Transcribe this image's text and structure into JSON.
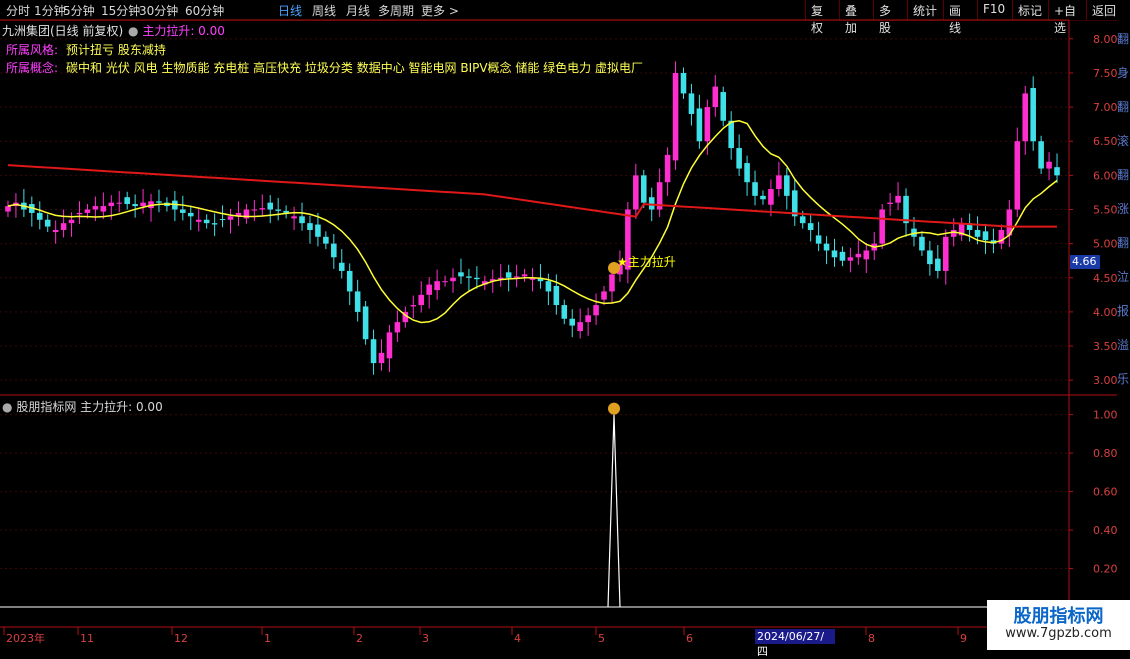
{
  "toolbar": {
    "left_items": [
      {
        "label": "分时",
        "active": false
      },
      {
        "label": "1分钟",
        "active": false
      },
      {
        "label": "5分钟",
        "active": false
      },
      {
        "label": "15分钟",
        "active": false
      },
      {
        "label": "30分钟",
        "active": false
      },
      {
        "label": "60分钟",
        "active": false
      },
      {
        "label": "日线",
        "active": true
      },
      {
        "label": "周线",
        "active": false
      },
      {
        "label": "月线",
        "active": false
      },
      {
        "label": "多周期",
        "active": false
      },
      {
        "label": "更多 >",
        "active": false
      }
    ],
    "right_items": [
      "复权",
      "叠加",
      "多股",
      "统计",
      "画线",
      "F10",
      "标记",
      "+自选",
      "返回"
    ]
  },
  "main_panel": {
    "stock_title": "九洲集团(日线 前复权)",
    "indicator_label": "主力拉升: 0.00",
    "style_label": "所属风格:",
    "style_value": "预计扭亏 股东减持",
    "concept_label": "所属概念:",
    "concept_value": "碳中和 光伏 风电 生物质能 充电桩 高压快充 垃圾分类 数据中心 智能电网 BIPV概念 储能 绿色电力 虚拟电厂",
    "signal_text": "★主力拉升",
    "current_price_tag": "4.66",
    "y_ticks": [
      "8.00",
      "7.50",
      "7.00",
      "6.50",
      "6.00",
      "5.50",
      "5.00",
      "4.50",
      "4.00",
      "3.50",
      "3.00"
    ]
  },
  "sub_panel": {
    "title": "股朋指标网 主力拉升: 0.00",
    "y_ticks": [
      "1.00",
      "0.80",
      "0.60",
      "0.40",
      "0.20"
    ]
  },
  "x_axis": {
    "labels": [
      "2023年",
      "11",
      "12",
      "1",
      "2",
      "3",
      "4",
      "5",
      "6",
      "2024/06/27/四",
      "8",
      "9"
    ]
  },
  "right_strip_text": "翻身 翻滚 翻涨 翻 泣 报 溢 乐",
  "watermark": {
    "line1": "股朋指标网",
    "line2": "www.7gpzb.com"
  },
  "colors": {
    "up": "#ff2ed0",
    "down": "#40e0e8",
    "ma_short": "#ffff33",
    "ma_long": "#e01818",
    "axis": "#b01010",
    "active_tab": "#4aa3ff",
    "signal": "#ffff00"
  },
  "chart_data": {
    "type": "candlestick",
    "price_range": [
      2.9,
      8.1
    ],
    "ma_short_name": "",
    "ma_long_name": "",
    "candles_close": [
      5.55,
      5.6,
      5.5,
      5.45,
      5.35,
      5.25,
      5.2,
      5.3,
      5.35,
      5.45,
      5.5,
      5.55,
      5.55,
      5.6,
      5.6,
      5.58,
      5.55,
      5.6,
      5.62,
      5.6,
      5.55,
      5.5,
      5.45,
      5.4,
      5.35,
      5.3,
      5.28,
      5.35,
      5.4,
      5.45,
      5.5,
      5.5,
      5.52,
      5.5,
      5.48,
      5.45,
      5.4,
      5.3,
      5.2,
      5.1,
      5.0,
      4.8,
      4.6,
      4.3,
      4.0,
      3.6,
      3.25,
      3.4,
      3.7,
      3.85,
      4.0,
      4.1,
      4.25,
      4.4,
      4.45,
      4.45,
      4.5,
      4.52,
      4.5,
      4.48,
      4.45,
      4.48,
      4.5,
      4.5,
      4.52,
      4.55,
      4.5,
      4.45,
      4.3,
      4.1,
      3.9,
      3.8,
      3.85,
      3.95,
      4.1,
      4.3,
      4.55,
      4.7,
      5.5,
      6.0,
      5.6,
      5.5,
      5.9,
      6.3,
      7.5,
      7.2,
      6.9,
      6.5,
      7.0,
      7.3,
      6.8,
      6.4,
      6.1,
      5.9,
      5.7,
      5.65,
      5.8,
      6.0,
      5.7,
      5.4,
      5.3,
      5.2,
      5.0,
      4.9,
      4.8,
      4.75,
      4.8,
      4.85,
      4.9,
      5.0,
      5.5,
      5.6,
      5.7,
      5.3,
      5.1,
      4.9,
      4.7,
      4.6,
      5.1,
      5.2,
      5.3,
      5.2,
      5.1,
      5.05,
      5.0,
      5.2,
      5.5,
      6.5,
      7.2,
      6.5,
      6.1,
      6.2,
      6.0
    ],
    "signal_series": {
      "name": "主力拉升",
      "peak_value": 1.0,
      "peak_label": "$"
    }
  }
}
